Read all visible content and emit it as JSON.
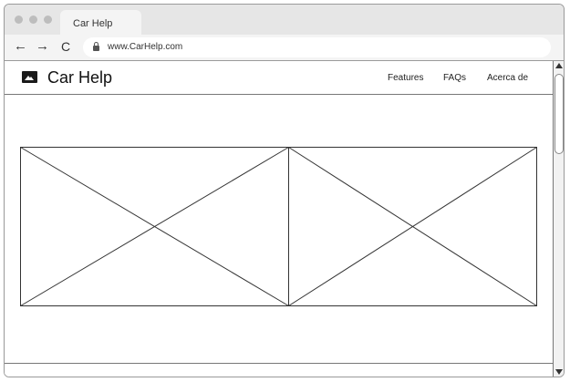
{
  "browser": {
    "tab_title": "Car Help",
    "url": "www.CarHelp.com",
    "nav": {
      "back": "←",
      "forward": "→",
      "reload": "C"
    }
  },
  "site": {
    "brand": "Car Help",
    "nav_links": [
      "Features",
      "FAQs",
      "Acerca de"
    ]
  },
  "icons": {
    "logo": "image-icon",
    "lock": "lock-icon"
  }
}
